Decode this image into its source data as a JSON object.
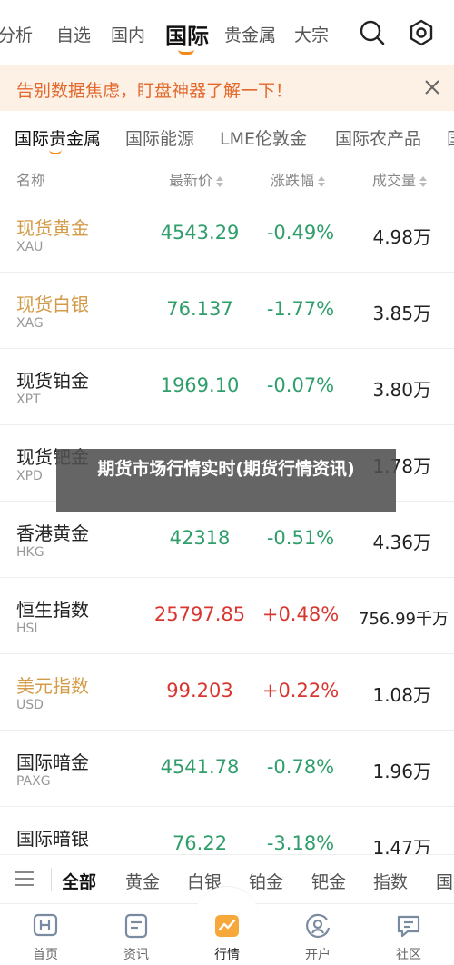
{
  "topnav": {
    "tabs": [
      "分析",
      "自选",
      "国内",
      "国际",
      "贵金属",
      "大宗"
    ],
    "active_index": 3,
    "icons": [
      "search-icon",
      "settings-icon"
    ]
  },
  "banner": {
    "text": "告别数据焦虑，盯盘神器了解一下！",
    "close_icon": "close-icon"
  },
  "subtabs": [
    "国际贵金属",
    "国际能源",
    "LME伦敦金",
    "国际农产品",
    "国"
  ],
  "table": {
    "headers": {
      "name": "名称",
      "price": "最新价",
      "change": "涨跌幅",
      "volume": "成交量"
    },
    "rows": [
      {
        "name": "现货黄金",
        "code": "XAU",
        "price": "4543.29",
        "change": "-0.49%",
        "volume": "4.98万",
        "highlight": true,
        "dir": "down"
      },
      {
        "name": "现货白银",
        "code": "XAG",
        "price": "76.137",
        "change": "-1.77%",
        "volume": "3.85万",
        "highlight": true,
        "dir": "down"
      },
      {
        "name": "现货铂金",
        "code": "XPT",
        "price": "1969.10",
        "change": "-0.07%",
        "volume": "3.80万",
        "highlight": false,
        "dir": "down"
      },
      {
        "name": "现货钯金",
        "code": "XPD",
        "price": "",
        "change": "",
        "volume": "1.78万",
        "highlight": false,
        "dir": "down"
      },
      {
        "name": "香港黄金",
        "code": "HKG",
        "price": "42318",
        "change": "-0.51%",
        "volume": "4.36万",
        "highlight": false,
        "dir": "down"
      },
      {
        "name": "恒生指数",
        "code": "HSI",
        "price": "25797.85",
        "change": "+0.48%",
        "volume": "756.99千万",
        "highlight": false,
        "dir": "up"
      },
      {
        "name": "美元指数",
        "code": "USD",
        "price": "99.203",
        "change": "+0.22%",
        "volume": "1.08万",
        "highlight": true,
        "dir": "up"
      },
      {
        "name": "国际暗金",
        "code": "PAXG",
        "price": "4541.78",
        "change": "-0.78%",
        "volume": "1.96万",
        "highlight": false,
        "dir": "down"
      },
      {
        "name": "国际暗银",
        "code": "",
        "price": "76.22",
        "change": "-3.18%",
        "volume": "1.47万",
        "highlight": false,
        "dir": "down"
      }
    ]
  },
  "overlay": {
    "text": "期货市场行情实时(期货行情资讯)"
  },
  "filterbar": {
    "menu_icon": "menu-icon",
    "items": [
      "全部",
      "黄金",
      "白银",
      "铂金",
      "钯金",
      "指数",
      "国"
    ],
    "active_index": 0
  },
  "bottomnav": {
    "items": [
      {
        "label": "首页",
        "icon": "home-icon"
      },
      {
        "label": "资讯",
        "icon": "news-icon"
      },
      {
        "label": "行情",
        "icon": "market-chart-icon"
      },
      {
        "label": "开户",
        "icon": "account-icon"
      },
      {
        "label": "社区",
        "icon": "community-icon"
      }
    ],
    "active_index": 2
  },
  "colors": {
    "accent": "#f08a1c",
    "banner_text": "#e2682c",
    "gold_name": "#d39b47",
    "up": "#d8362f",
    "down": "#2f9e6b"
  }
}
